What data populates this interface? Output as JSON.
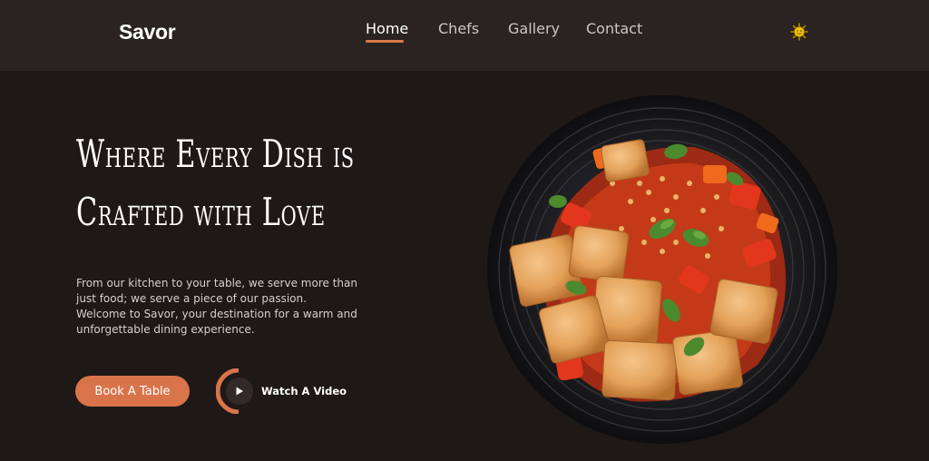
{
  "header": {
    "logo": "Savor",
    "nav": [
      {
        "label": "Home",
        "active": true
      },
      {
        "label": "Chefs",
        "active": false
      },
      {
        "label": "Gallery",
        "active": false
      },
      {
        "label": "Contact",
        "active": false
      }
    ],
    "theme_icon": "sun-icon"
  },
  "hero": {
    "title_line1": "Where Every Dish is",
    "title_line2": "Crafted with Love",
    "description": "From our kitchen to your table, we serve more than just food; we serve a piece of our passion. Welcome to Savor, your destination for a warm and unforgettable dining experience.",
    "book_button": "Book A Table",
    "video_button": "Watch A Video",
    "video_icon": "play-icon"
  },
  "colors": {
    "accent": "#d9744a",
    "background": "#1e1817",
    "header_background": "#2b2322",
    "sun": "#f2c100"
  }
}
